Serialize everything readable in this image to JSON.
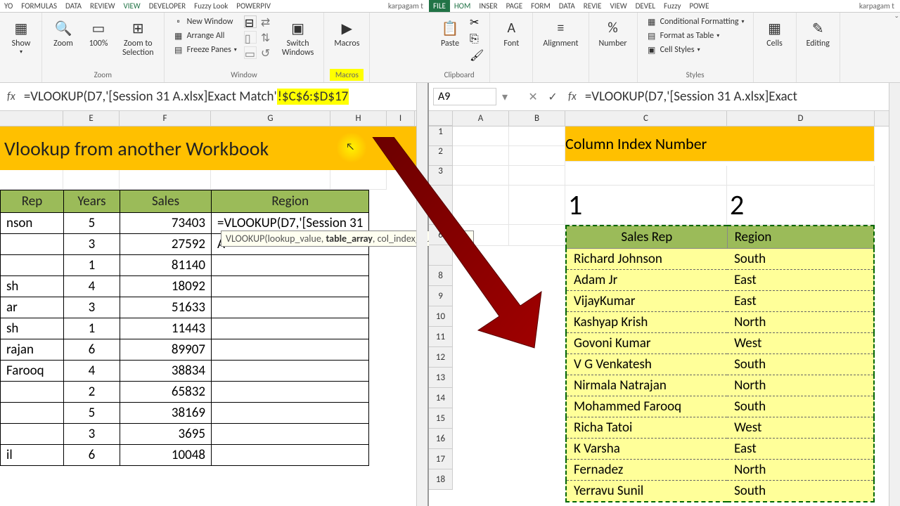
{
  "left_tabs": [
    "YO",
    "FORMULAS",
    "DATA",
    "REVIEW",
    "VIEW",
    "DEVELOPER",
    "Fuzzy Look",
    "POWERPIV"
  ],
  "left_tabs_active": "VIEW",
  "left_user": "karpagam t",
  "right_tabs": [
    "FILE",
    "HOM",
    "INSER",
    "PAGE",
    "FORM",
    "DATA",
    "REVIE",
    "VIEW",
    "DEVEL",
    "Fuzzy",
    "POWE"
  ],
  "right_tabs_green": "FILE",
  "right_tabs_active": "HOM",
  "right_user": "karpagam t",
  "ribbon_left": {
    "show": "Show",
    "zoom": "Zoom",
    "zoom100": "100%",
    "zoom_sel": "Zoom to\nSelection",
    "zoom_label": "Zoom",
    "new_window": "New Window",
    "arrange_all": "Arrange All",
    "freeze_panes": "Freeze Panes",
    "switch_windows": "Switch\nWindows",
    "window_label": "Window",
    "macros": "Macros",
    "macros_label": "Macros"
  },
  "ribbon_right": {
    "paste": "Paste",
    "clipboard_label": "Clipboard",
    "font": "Font",
    "alignment": "Alignment",
    "number": "Number",
    "cond_fmt": "Conditional Formatting",
    "fmt_table": "Format as Table",
    "cell_styles": "Cell Styles",
    "styles_label": "Styles",
    "cells": "Cells",
    "editing": "Editing"
  },
  "left_formula_prefix": "=VLOOKUP(D7,'[Session 31 A.xlsx]Exact Match'",
  "left_formula_hl": "!$C$6:$D$17",
  "right_namebox": "A9",
  "right_formula": "=VLOOKUP(D7,'[Session 31 A.xlsx]Exact",
  "left_cols": [
    "E",
    "F",
    "G",
    "H",
    "I"
  ],
  "right_cols": [
    "A",
    "B",
    "C",
    "D"
  ],
  "right_rows": [
    "1",
    "2",
    "3",
    "",
    "",
    "6",
    "",
    "8",
    "9",
    "10",
    "11",
    "12",
    "13",
    "14",
    "15",
    "16",
    "17",
    "18"
  ],
  "left_title": "Vlookup  from another Workbook",
  "left_headers": {
    "rep": "Rep",
    "years": "Years",
    "sales": "Sales",
    "region": "Region"
  },
  "left_data": [
    {
      "rep": "nson",
      "years": "5",
      "sales": "73403",
      "region_formula": "=VLOOKUP(D7,'[Session 31"
    },
    {
      "rep": "",
      "years": "3",
      "sales": "27592",
      "region_formula": "A"
    },
    {
      "rep": "",
      "years": "1",
      "sales": "81140",
      "region_formula": ""
    },
    {
      "rep": "sh",
      "years": "4",
      "sales": "18092",
      "region_formula": ""
    },
    {
      "rep": "ar",
      "years": "3",
      "sales": "51633",
      "region_formula": ""
    },
    {
      "rep": "sh",
      "years": "1",
      "sales": "11443",
      "region_formula": ""
    },
    {
      "rep": "rajan",
      "years": "6",
      "sales": "89907",
      "region_formula": ""
    },
    {
      "rep": "Farooq",
      "years": "4",
      "sales": "38834",
      "region_formula": ""
    },
    {
      "rep": "",
      "years": "2",
      "sales": "65832",
      "region_formula": ""
    },
    {
      "rep": "",
      "years": "5",
      "sales": "38169",
      "region_formula": ""
    },
    {
      "rep": "",
      "years": "3",
      "sales": "3695",
      "region_formula": ""
    },
    {
      "rep": "il",
      "years": "6",
      "sales": "10048",
      "region_formula": ""
    }
  ],
  "tooltip_prefix": "VLOOKUP(lookup_value, ",
  "tooltip_bold": "table_array",
  "tooltip_suffix": ", col_index_num, [range",
  "right_title": "Column Index Number",
  "right_colnum1": "1",
  "right_colnum2": "2",
  "right_headers": {
    "rep": "Sales Rep",
    "region": "Region"
  },
  "right_data": [
    {
      "rep": "Richard Johnson",
      "region": "South"
    },
    {
      "rep": "Adam Jr",
      "region": "East"
    },
    {
      "rep": "VijayKumar",
      "region": "East"
    },
    {
      "rep": "Kashyap Krish",
      "region": "North"
    },
    {
      "rep": "Govoni Kumar",
      "region": "West"
    },
    {
      "rep": "V G Venkatesh",
      "region": "South"
    },
    {
      "rep": "Nirmala Natrajan",
      "region": "North"
    },
    {
      "rep": "Mohammed Farooq",
      "region": "South"
    },
    {
      "rep": "Richa Tatoi",
      "region": "West"
    },
    {
      "rep": "K Varsha",
      "region": "East"
    },
    {
      "rep": "Fernadez",
      "region": "North"
    },
    {
      "rep": "Yerravu Sunil",
      "region": "South"
    }
  ]
}
